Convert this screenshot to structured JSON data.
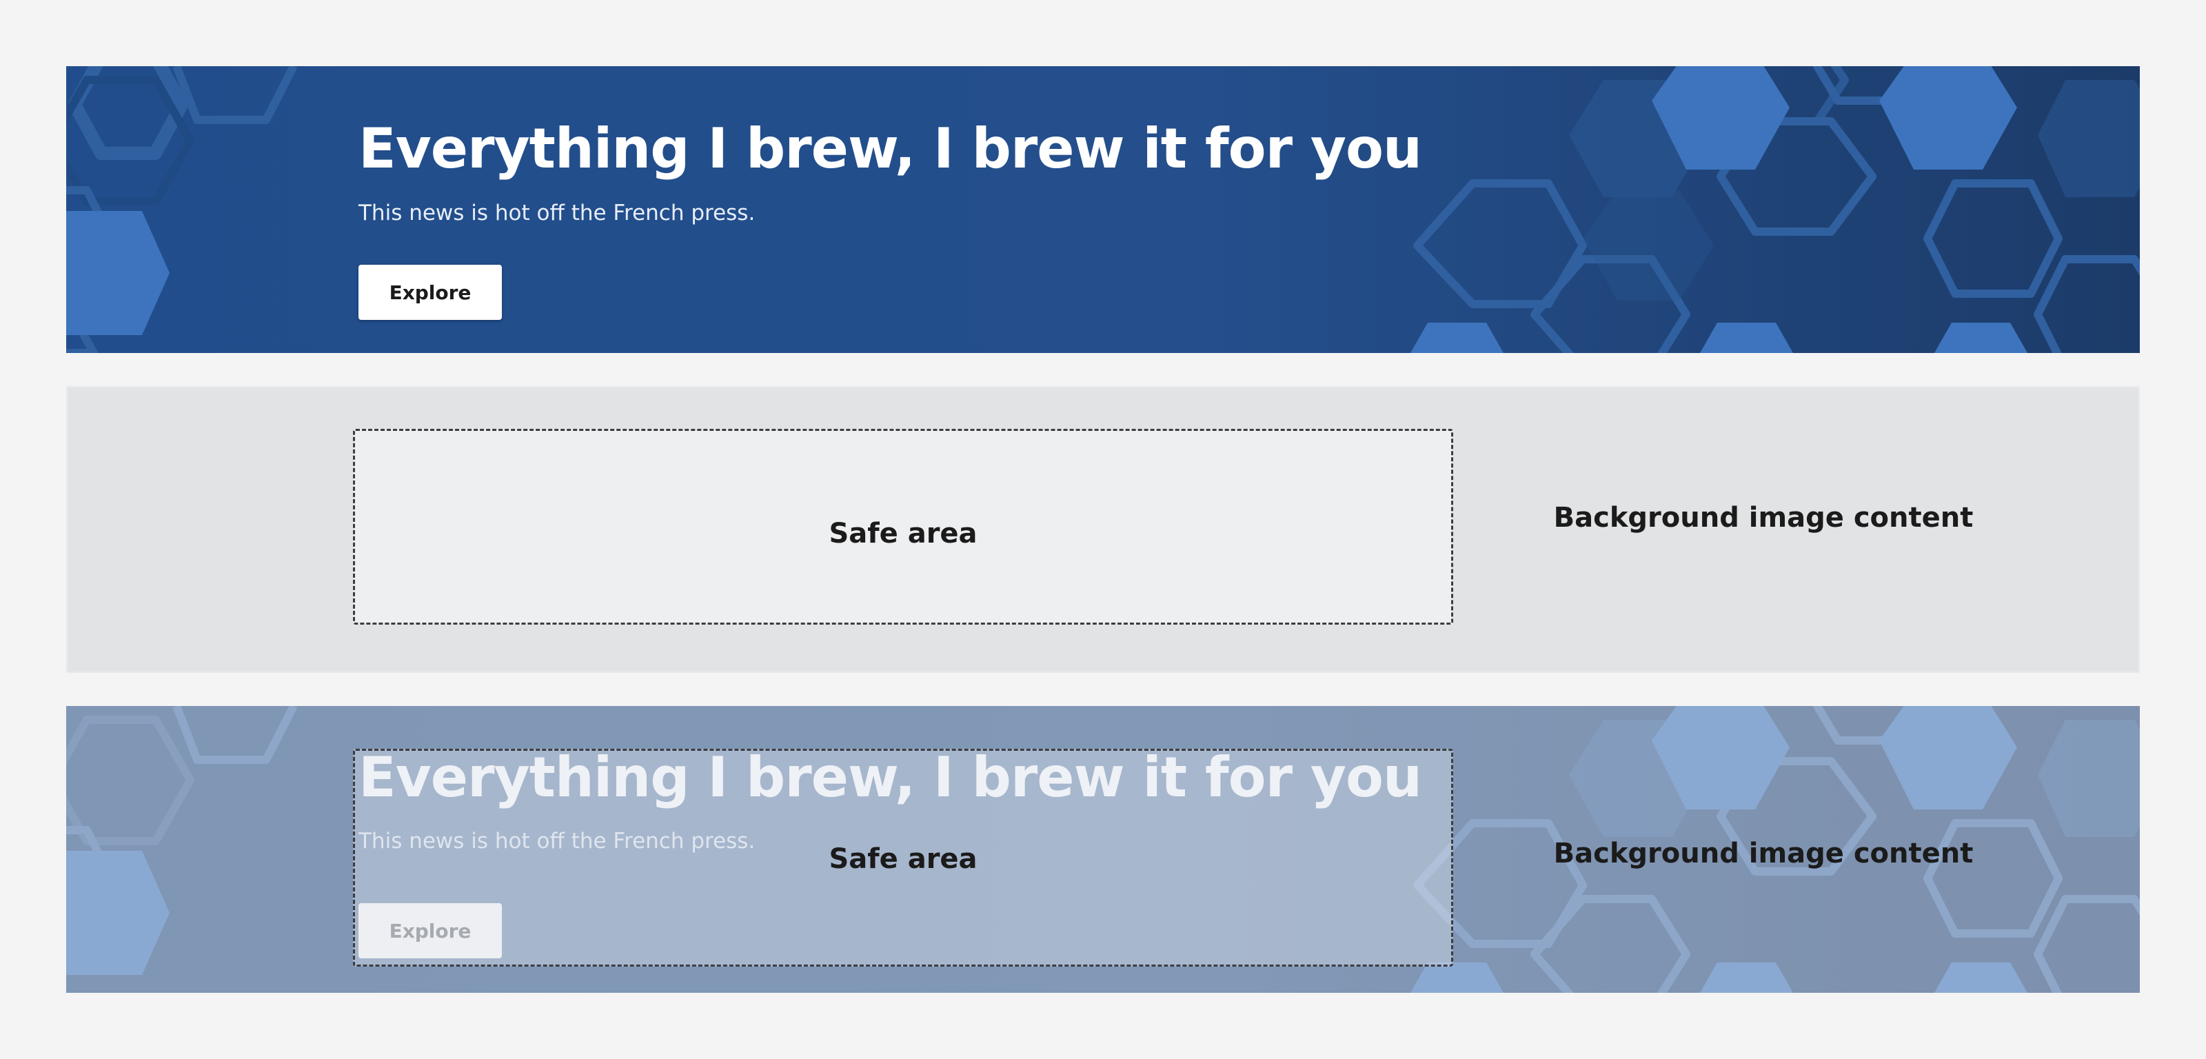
{
  "hero": {
    "title": "Everything I brew, I brew it for you",
    "subtitle": "This news is hot off the French press.",
    "button_label": "Explore"
  },
  "diagram": {
    "safe_area_label": "Safe area",
    "background_label": "Background image content"
  },
  "overlay": {
    "title": "Everything I brew, I brew it for you",
    "subtitle": "This news is hot off the French press.",
    "button_label": "Explore",
    "safe_area_label": "Safe area",
    "background_label": "Background image content"
  },
  "colors": {
    "page_background": "#f4f4f5",
    "hero_blue": "#214d8c",
    "hex_light_blue": "#3c73bd",
    "diagram_gray": "#e2e3e5"
  },
  "icons": {
    "hex_pattern": "hexagon-pattern"
  }
}
